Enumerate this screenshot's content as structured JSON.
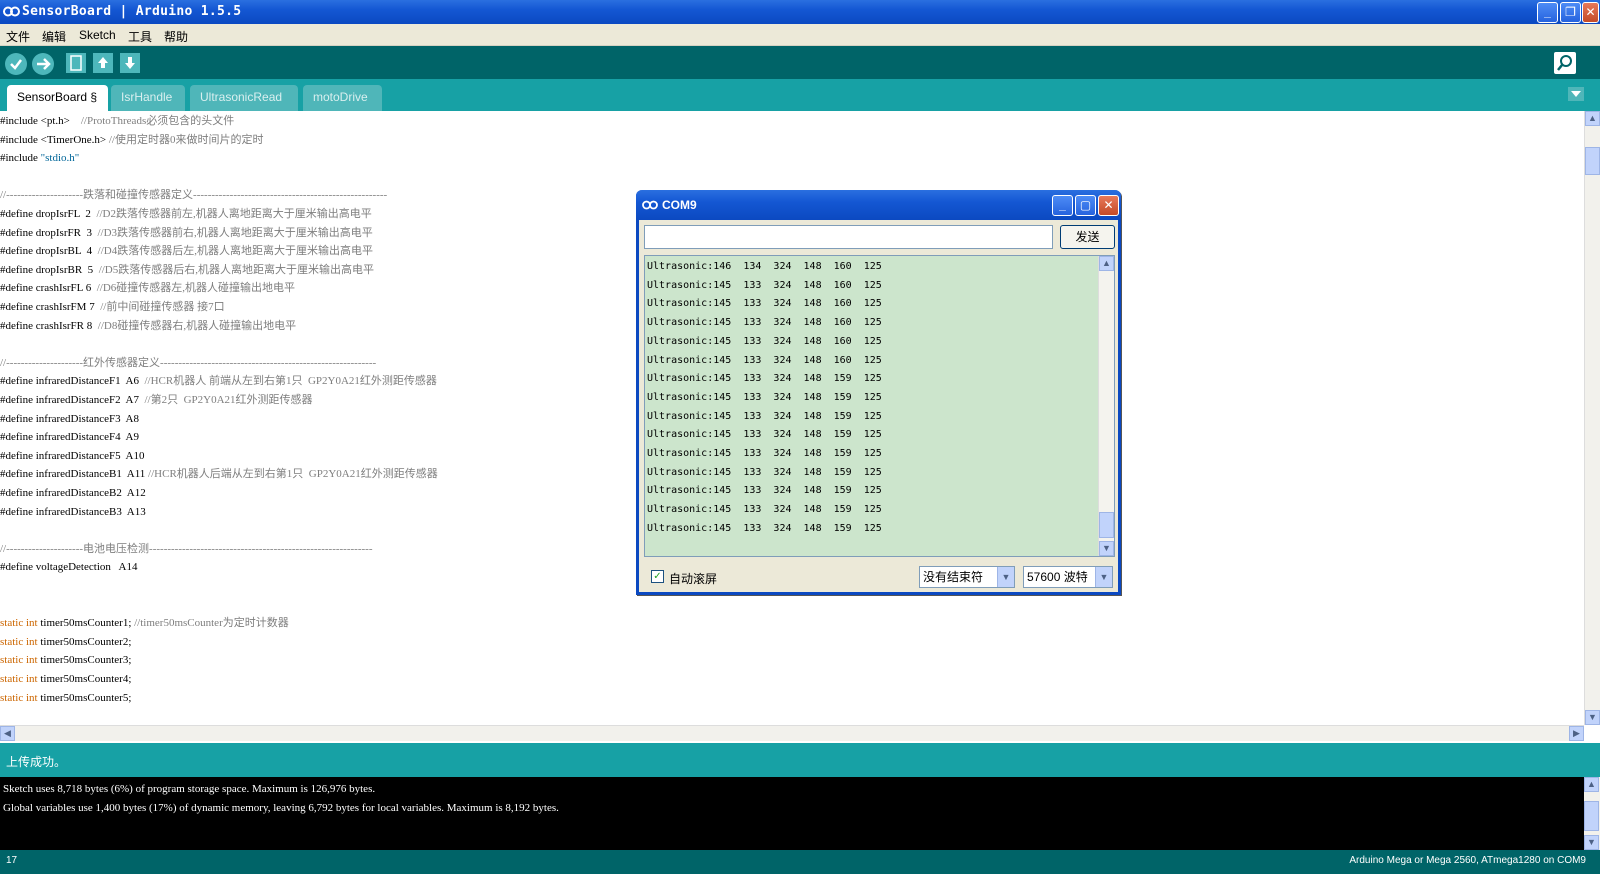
{
  "window": {
    "title": "SensorBoard | Arduino 1.5.5",
    "minimize": "_",
    "maximize": "❐",
    "close": "✕"
  },
  "menu": [
    "文件",
    "编辑",
    "Sketch",
    "工具",
    "帮助"
  ],
  "tabs": [
    "SensorBoard §",
    "IsrHandle",
    "UltrasonicRead",
    "motoDrive"
  ],
  "code_lines": [
    {
      "t": "#include <pt.h>    ",
      "c": "//ProtoThreads必须包含的头文件"
    },
    {
      "t": "#include <TimerOne.h> ",
      "c": "//使用定时器0来做时间片的定时"
    },
    {
      "t": "#include ",
      "s": "\"stdio.h\""
    },
    {
      "t": ""
    },
    {
      "t": "",
      "c": "//---------------------跌落和碰撞传感器定义-----------------------------------------------------"
    },
    {
      "t": "#define dropIsrFL  2  ",
      "c": "//D2跌落传感器前左,机器人离地距离大于厘米输出高电平"
    },
    {
      "t": "#define dropIsrFR  3  ",
      "c": "//D3跌落传感器前右,机器人离地距离大于厘米输出高电平"
    },
    {
      "t": "#define dropIsrBL  4  ",
      "c": "//D4跌落传感器后左,机器人离地距离大于厘米输出高电平"
    },
    {
      "t": "#define dropIsrBR  5  ",
      "c": "//D5跌落传感器后右,机器人离地距离大于厘米输出高电平"
    },
    {
      "t": "#define crashIsrFL 6  ",
      "c": "//D6碰撞传感器左,机器人碰撞输出地电平"
    },
    {
      "t": "#define crashIsrFM 7  ",
      "c": "//前中间碰撞传感器 接7口"
    },
    {
      "t": "#define crashIsrFR 8  ",
      "c": "//D8碰撞传感器右,机器人碰撞输出地电平"
    },
    {
      "t": ""
    },
    {
      "t": "",
      "c": "//---------------------红外传感器定义-----------------------------------------------------------"
    },
    {
      "t": "#define infraredDistanceF1  A6  ",
      "c": "//HCR机器人 前端从左到右第1只  GP2Y0A21红外测距传感器"
    },
    {
      "t": "#define infraredDistanceF2  A7  ",
      "c": "//第2只  GP2Y0A21红外测距传感器"
    },
    {
      "t": "#define infraredDistanceF3  A8"
    },
    {
      "t": "#define infraredDistanceF4  A9"
    },
    {
      "t": "#define infraredDistanceF5  A10"
    },
    {
      "t": "#define infraredDistanceB1  A11 ",
      "c": "//HCR机器人后端从左到右第1只  GP2Y0A21红外测距传感器"
    },
    {
      "t": "#define infraredDistanceB2  A12"
    },
    {
      "t": "#define infraredDistanceB3  A13"
    },
    {
      "t": ""
    },
    {
      "t": "",
      "c": "//---------------------电池电压检测-------------------------------------------------------------"
    },
    {
      "t": "#define voltageDetection   A14"
    },
    {
      "t": ""
    },
    {
      "t": ""
    },
    {
      "t": "",
      "k": "static int ",
      "r": "timer50msCounter1; ",
      "c": "//timer50msCounter为定时计数器"
    },
    {
      "t": "",
      "k": "static int ",
      "r": "timer50msCounter2;"
    },
    {
      "t": "",
      "k": "static int ",
      "r": "timer50msCounter3;"
    },
    {
      "t": "",
      "k": "static int ",
      "r": "timer50msCounter4;"
    },
    {
      "t": "",
      "k": "static int ",
      "r": "timer50msCounter5;"
    }
  ],
  "serial_monitor": {
    "title": "COM9",
    "input_value": "",
    "send_label": "发送",
    "lines": [
      "Ultrasonic:146  134  324  148  160  125",
      "Ultrasonic:145  133  324  148  160  125",
      "Ultrasonic:145  133  324  148  160  125",
      "Ultrasonic:145  133  324  148  160  125",
      "Ultrasonic:145  133  324  148  160  125",
      "Ultrasonic:145  133  324  148  160  125",
      "Ultrasonic:145  133  324  148  159  125",
      "Ultrasonic:145  133  324  148  159  125",
      "Ultrasonic:145  133  324  148  159  125",
      "Ultrasonic:145  133  324  148  159  125",
      "Ultrasonic:145  133  324  148  159  125",
      "Ultrasonic:145  133  324  148  159  125",
      "Ultrasonic:145  133  324  148  159  125",
      "Ultrasonic:145  133  324  148  159  125",
      "Ultrasonic:145  133  324  148  159  125"
    ],
    "autoscroll_label": "自动滚屏",
    "autoscroll_checked": true,
    "line_ending": "没有结束符",
    "baud": "57600 波特"
  },
  "status": "上传成功。",
  "console": [
    "Sketch uses 8,718 bytes (6%) of program storage space. Maximum is 126,976 bytes.",
    "Global variables use 1,400 bytes (17%) of dynamic memory, leaving 6,792 bytes for local variables. Maximum is 8,192 bytes."
  ],
  "footer": {
    "line": "17",
    "board": "Arduino Mega or Mega 2560, ATmega1280 on COM9"
  },
  "colors": {
    "toolbar": "#006468",
    "tabbar": "#17a1a5",
    "serial_output_bg": "#cce5cc",
    "keyword": "#cc6600",
    "comment": "#7e7e7e"
  }
}
